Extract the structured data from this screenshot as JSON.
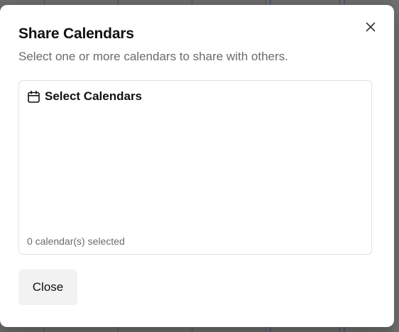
{
  "modal": {
    "title": "Share Calendars",
    "subtitle": "Select one or more calendars to share with others.",
    "close_icon": "close-icon"
  },
  "calendar_picker": {
    "icon": "calendar-icon",
    "title": "Select Calendars",
    "selected_count_text": "0 calendar(s) selected"
  },
  "footer": {
    "close_label": "Close"
  },
  "colors": {
    "overlay": "#6b6b6b",
    "modal_bg": "#ffffff",
    "title": "#111111",
    "muted_text": "#6b6b6b",
    "border": "#e2e2e2",
    "button_bg": "#f2f2f2"
  }
}
